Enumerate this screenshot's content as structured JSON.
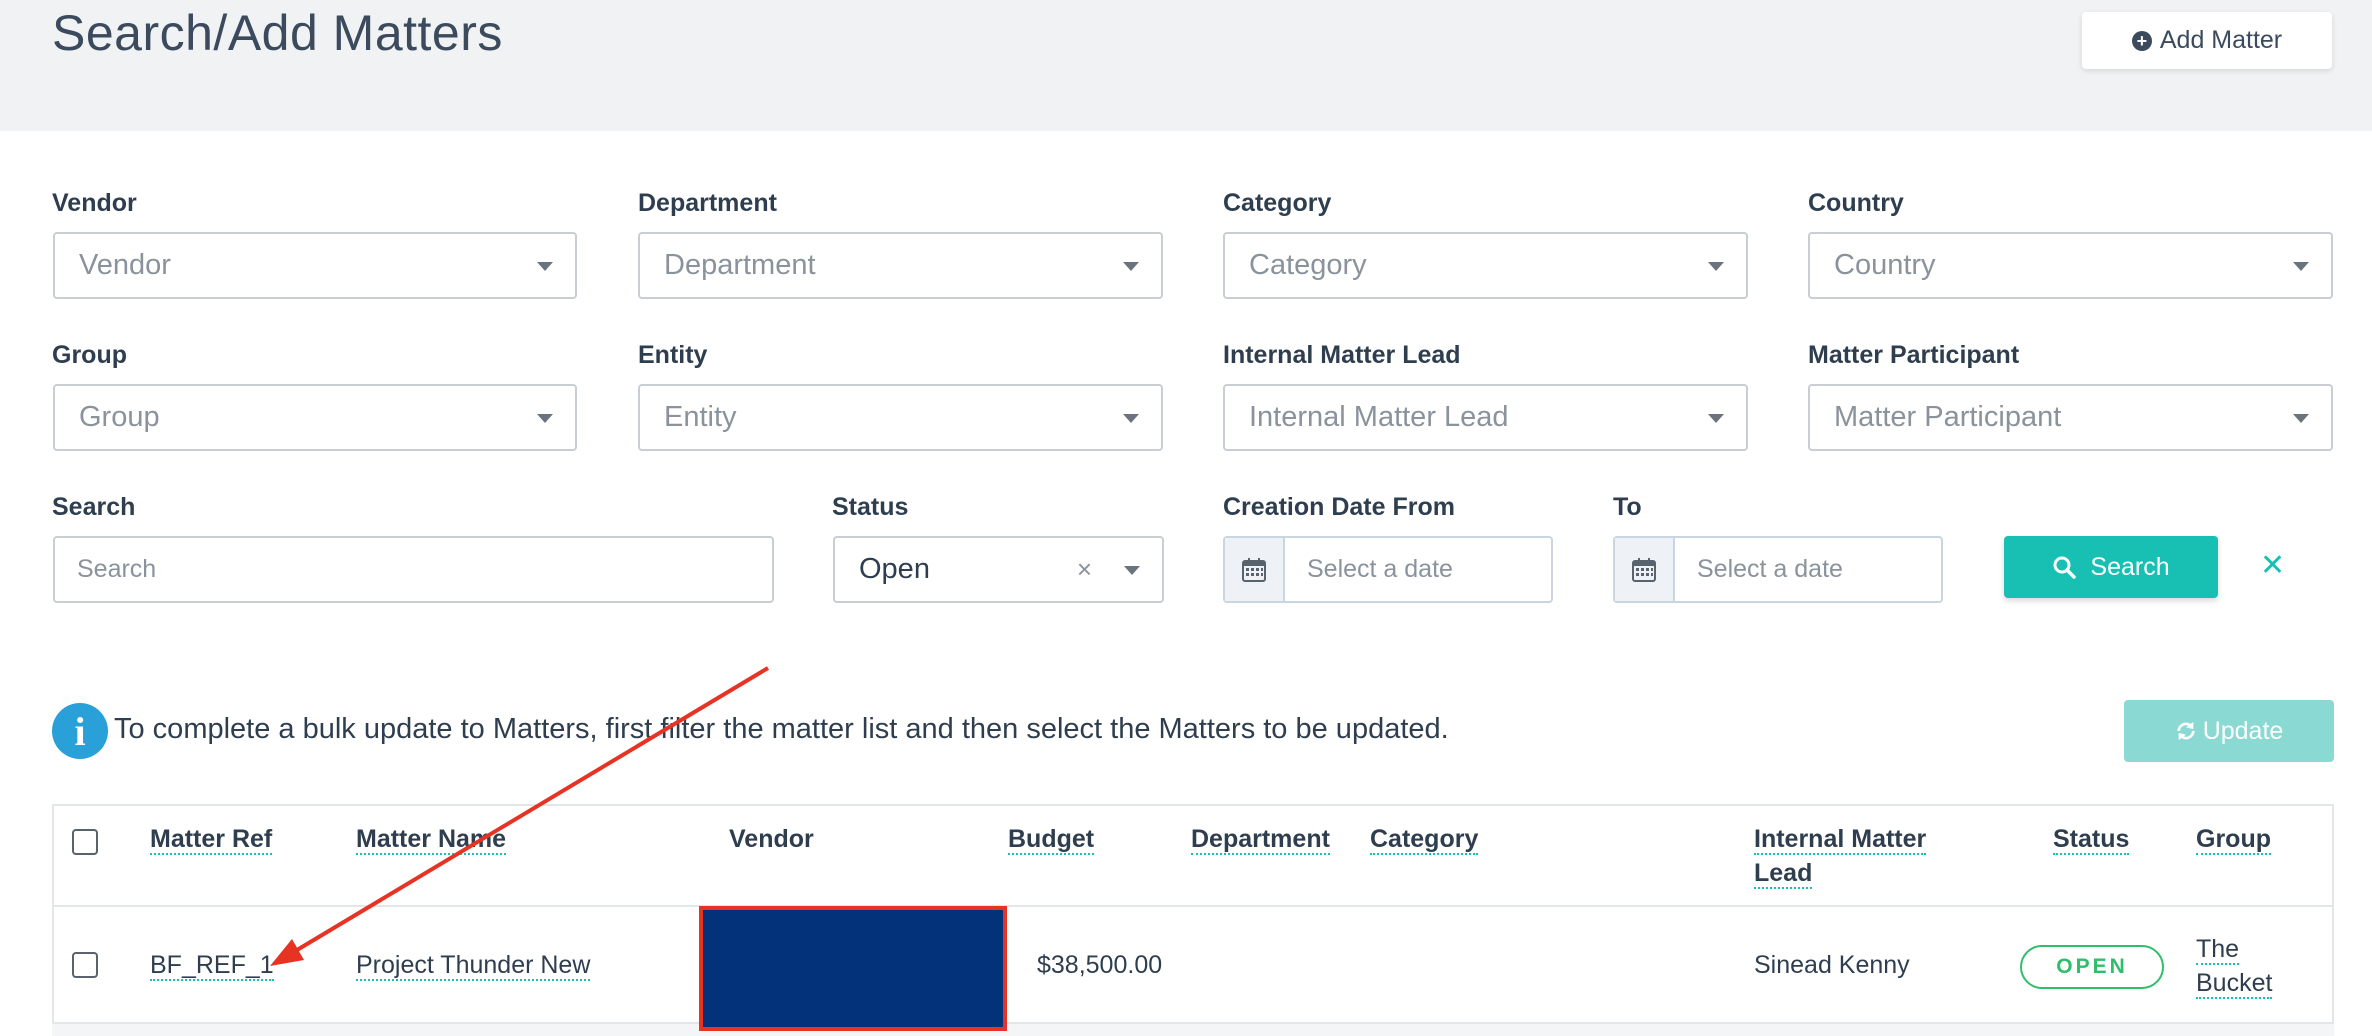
{
  "header": {
    "title": "Search/Add Matters",
    "add_matter_label": "Add Matter"
  },
  "filters": {
    "vendor": {
      "label": "Vendor",
      "placeholder": "Vendor"
    },
    "department": {
      "label": "Department",
      "placeholder": "Department"
    },
    "category": {
      "label": "Category",
      "placeholder": "Category"
    },
    "country": {
      "label": "Country",
      "placeholder": "Country"
    },
    "group": {
      "label": "Group",
      "placeholder": "Group"
    },
    "entity": {
      "label": "Entity",
      "placeholder": "Entity"
    },
    "internal_matter_lead": {
      "label": "Internal Matter Lead",
      "placeholder": "Internal Matter Lead"
    },
    "matter_participant": {
      "label": "Matter Participant",
      "placeholder": "Matter Participant"
    },
    "search": {
      "label": "Search",
      "placeholder": "Search"
    },
    "status": {
      "label": "Status",
      "value": "Open",
      "clear_glyph": "×"
    },
    "creation_date_from": {
      "label": "Creation Date From",
      "placeholder": "Select a date"
    },
    "to": {
      "label": "To",
      "placeholder": "Select a date"
    },
    "search_button_label": "Search",
    "clear_glyph": "✕"
  },
  "bulk": {
    "info_glyph": "i",
    "message": "To complete a bulk update to Matters, first filter the matter list and then select the Matters to be updated.",
    "update_label": "Update"
  },
  "table": {
    "headers": {
      "matter_ref": "Matter Ref",
      "matter_name": "Matter Name",
      "vendor": "Vendor",
      "budget": "Budget",
      "department": "Department",
      "category": "Category",
      "internal_matter_lead_1": "Internal Matter",
      "internal_matter_lead_2": "Lead",
      "status": "Status",
      "group": "Group"
    },
    "rows": [
      {
        "matter_ref": "BF_REF_1",
        "matter_name": "Project Thunder New",
        "budget": "$38,500.00",
        "internal_matter_lead": "Sinead Kenny",
        "status": "OPEN",
        "group_1": "The",
        "group_2": "Bucket"
      }
    ]
  },
  "colors": {
    "accent": "#17c0b3",
    "status_open": "#2fbf6b",
    "redacted_vendor": "#03327a",
    "annotation_red": "#e63323",
    "info_blue": "#2aa0d8"
  },
  "icons": [
    "plus-circle-icon",
    "chevron-down-icon",
    "calendar-icon",
    "search-icon",
    "refresh-icon",
    "info-icon",
    "close-icon"
  ]
}
